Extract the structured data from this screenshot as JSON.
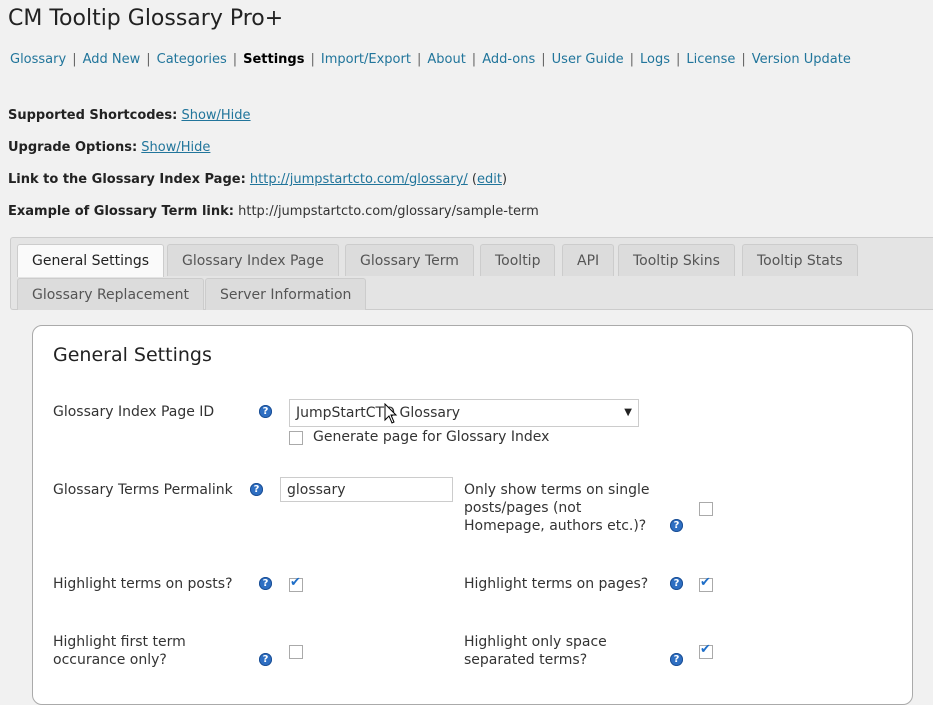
{
  "page_title": "CM Tooltip Glossary Pro+",
  "nav": {
    "items": [
      "Glossary",
      "Add New",
      "Categories",
      "Settings",
      "Import/Export",
      "About",
      "Add-ons",
      "User Guide",
      "Logs",
      "License",
      "Version Update"
    ],
    "current": "Settings",
    "separator": "|"
  },
  "info": {
    "shortcodes_label": "Supported Shortcodes:",
    "shortcodes_link": "Show/Hide",
    "upgrade_label": "Upgrade Options:",
    "upgrade_link": "Show/Hide",
    "index_label": "Link to the Glossary Index Page:",
    "index_url": "http://jumpstartcto.com/glossary/",
    "edit_open": "(",
    "edit_link": "edit",
    "edit_close": ")",
    "example_label": "Example of Glossary Term link:",
    "example_url": "http://jumpstartcto.com/glossary/sample-term"
  },
  "tabs": {
    "row1": [
      "General Settings",
      "Glossary Index Page",
      "Glossary Term",
      "Tooltip",
      "API",
      "Tooltip Skins",
      "Tooltip Stats"
    ],
    "row2": [
      "Glossary Replacement",
      "Server Information"
    ],
    "active": "General Settings"
  },
  "panel": {
    "title": "General Settings",
    "index_page_label": "Glossary Index Page ID",
    "index_page_value": "JumpStartCTO Glossary",
    "generate_label": "Generate page for Glossary Index",
    "permalink_label": "Glossary Terms Permalink",
    "permalink_value": "glossary",
    "single_posts_label": "Only show terms on single posts/pages (not Homepage, authors etc.)?",
    "highlight_posts_label": "Highlight terms on posts?",
    "highlight_pages_label": "Highlight terms on pages?",
    "first_term_label": "Highlight first term occurance only?",
    "space_separated_label": "Highlight only space separated terms?",
    "checks": {
      "generate": false,
      "single_posts": false,
      "highlight_posts": true,
      "highlight_pages": true,
      "first_term": false,
      "space_separated": true
    },
    "help_glyph": "?",
    "check_glyph": "✔",
    "arrow_glyph": "▼"
  },
  "colors": {
    "link": "#21759b",
    "background": "#f1f1f1",
    "help_icon": "#2e6fc3",
    "check_mark": "#1e6ec8"
  }
}
